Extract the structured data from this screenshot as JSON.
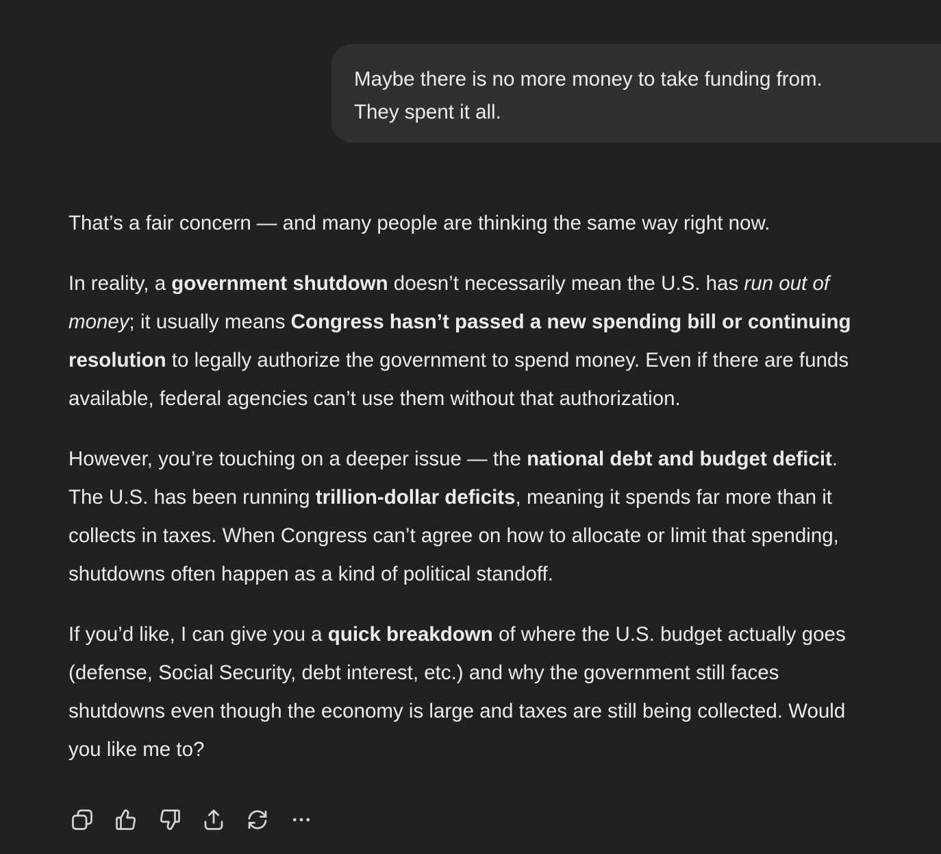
{
  "user_message": {
    "lines": [
      "Maybe there is no more money to take funding from.",
      "They spent it all."
    ]
  },
  "assistant": {
    "p1": {
      "l1": "That’s a fair concern — and many people are thinking the same way right now."
    },
    "p2": {
      "l1a": "In reality, a ",
      "l1b": "government shutdown",
      "l1c": " doesn’t necessarily mean the U.S. has ",
      "l1d": "run out of",
      "l2a": "money",
      "l2b": "; it usually means ",
      "l2c": "Congress hasn’t passed a new spending bill or continuing",
      "l3a": "resolution",
      "l3b": " to legally authorize the government to spend money. Even if there are funds",
      "l4": "available, federal agencies can’t use them without that authorization."
    },
    "p3": {
      "l1a": "However, you’re touching on a deeper issue — the ",
      "l1b": "national debt and budget deficit",
      "l1c": ".",
      "l2a": "The U.S. has been running ",
      "l2b": "trillion-dollar deficits",
      "l2c": ", meaning it spends far more than it",
      "l3": "collects in taxes. When Congress can’t agree on how to allocate or limit that spending,",
      "l4": "shutdowns often happen as a kind of political standoff."
    },
    "p4": {
      "l1a": "If you’d like, I can give you a ",
      "l1b": "quick breakdown",
      "l1c": " of where the U.S. budget actually goes",
      "l2": "(defense, Social Security, debt interest, etc.) and why the government still faces",
      "l3": "shutdowns even though the economy is large and taxes are still being collected. Would",
      "l4": "you like me to?"
    }
  },
  "actions": {
    "icons": [
      "copy-icon",
      "thumbs-up-icon",
      "thumbs-down-icon",
      "share-icon",
      "regenerate-icon",
      "more-icon"
    ],
    "icon_color": "#d4d4d4"
  },
  "colors": {
    "background": "#212121",
    "bubble": "#303030",
    "text": "#ececec"
  }
}
